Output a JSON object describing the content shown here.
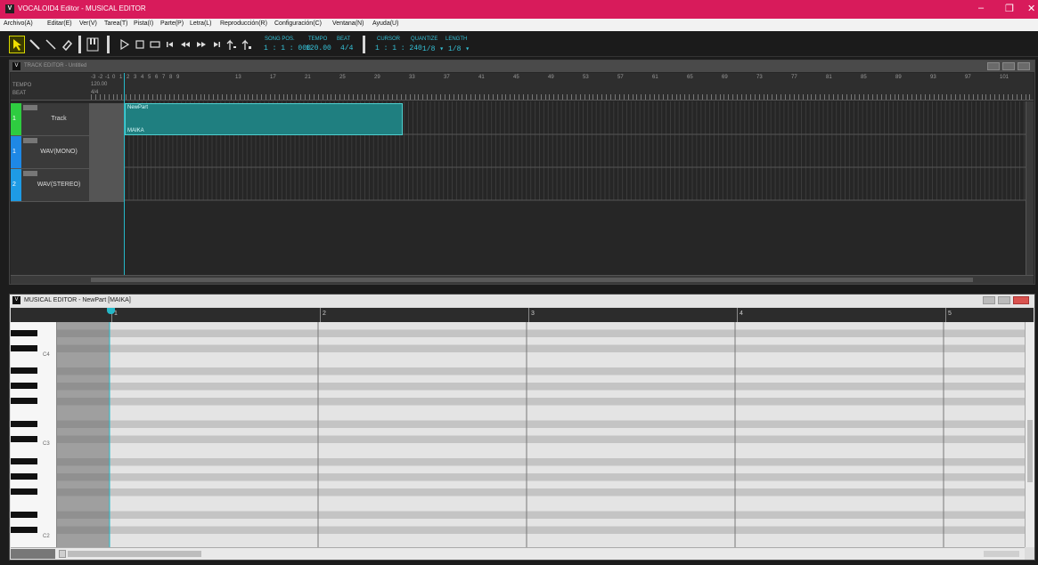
{
  "app": {
    "title": "VOCALOID4 Editor - MUSICAL EDITOR",
    "logo": "V"
  },
  "window_controls": {
    "minimize": "–",
    "restore": "❐",
    "close": "✕"
  },
  "menu": [
    "Archivo(A)",
    "Editar(E)",
    "Ver(V)",
    "Tarea(T)",
    "Pista(I)",
    "Parte(P)",
    "Letra(L)",
    "Reproducción(R)",
    "Configuración(C)",
    "Ventana(N)",
    "Ayuda(U)"
  ],
  "toolbar": {
    "tools": [
      "arrow-tool-icon",
      "pencil-tool-icon",
      "line-tool-icon",
      "eraser-tool-icon"
    ],
    "transport": [
      "play-icon",
      "stop-icon",
      "loop-icon",
      "rewind-start-icon",
      "rewind-icon",
      "fast-forward-icon",
      "forward-end-icon"
    ],
    "song_pos_label": "SONG POS.",
    "song_pos_value": "1 : 1 : 000",
    "tempo_label": "TEMPO",
    "tempo_value": "120.00",
    "beat_label": "BEAT",
    "beat_value": "4/4",
    "cursor_label": "CURSOR",
    "cursor_value": "1 : 1 : 240",
    "quantize_label": "QUANTIZE",
    "quantize_value": "1/8 ▾",
    "length_label": "LENGTH",
    "length_value": "1/8 ▾"
  },
  "track_editor": {
    "title": "TRACK EDITOR - Untitled",
    "tempo_label": "TEMPO",
    "beat_label": "BEAT",
    "tempo_value": "120.00",
    "beat_value": "4/4",
    "ruler_numbers": [
      "-3",
      "-2",
      "-1",
      "0",
      "1",
      "2",
      "3",
      "4",
      "5",
      "6",
      "7",
      "8",
      "9",
      "13",
      "17",
      "21",
      "25",
      "29",
      "33",
      "37",
      "41",
      "45",
      "49",
      "53",
      "57",
      "61",
      "65",
      "69",
      "73",
      "77",
      "81",
      "85",
      "89",
      "93",
      "97",
      "101"
    ],
    "tracks": [
      {
        "number": "1",
        "name": "Track",
        "color": "#2ecc40"
      },
      {
        "number": "1",
        "name": "WAV(MONO)",
        "color": "#1e88e5"
      },
      {
        "number": "2",
        "name": "WAV(STEREO)",
        "color": "#1e9be5"
      }
    ],
    "part": {
      "name": "NewPart",
      "singer": "MAIKA"
    }
  },
  "musical_editor": {
    "title": "MUSICAL EDITOR - NewPart [MAIKA]",
    "measures": [
      "1",
      "2",
      "3",
      "4",
      "5"
    ],
    "note_labels": [
      "C4",
      "C3",
      "C2"
    ]
  },
  "colors": {
    "accent": "#d81b5b",
    "cyan": "#35c2d8",
    "part": "#1f7f80"
  }
}
